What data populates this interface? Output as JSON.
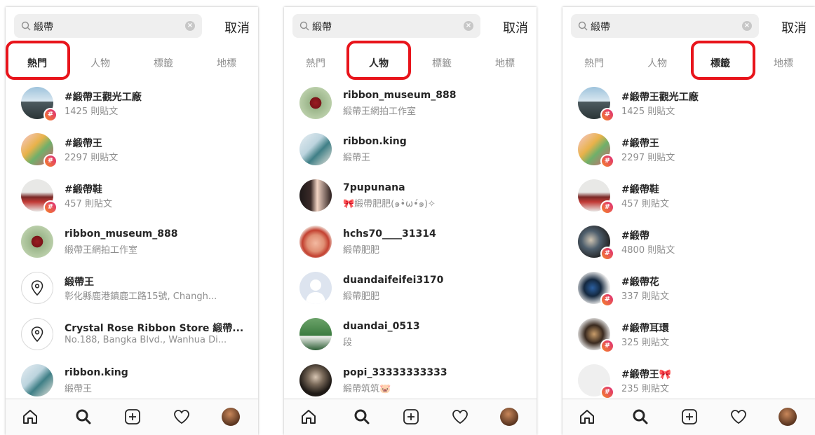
{
  "search": {
    "query": "緞帶",
    "cancel_label": "取消"
  },
  "tabs": [
    "熱門",
    "人物",
    "標籤",
    "地標"
  ],
  "accent_ring_color": "#e8141b",
  "screens": [
    {
      "active_tab": "熱門",
      "results": [
        {
          "title": "#緞帶王觀光工廠",
          "subtitle": "1425 則貼文",
          "kind": "hashtag",
          "avatar": "photo-sea"
        },
        {
          "title": "#緞帶王",
          "subtitle": "2297 則貼文",
          "kind": "hashtag",
          "avatar": "photo-shop"
        },
        {
          "title": "#緞帶鞋",
          "subtitle": "457 則貼文",
          "kind": "hashtag",
          "avatar": "photo-shoe"
        },
        {
          "title": "ribbon_museum_888",
          "subtitle": "緞帶王網拍工作室",
          "kind": "user",
          "avatar": "photo-bow"
        },
        {
          "title": "緞帶王",
          "subtitle": "彰化縣鹿港鎮鹿工路15號, Changh...",
          "kind": "place",
          "avatar": "location-pin-icon"
        },
        {
          "title": "Crystal Rose Ribbon Store 緞帶...",
          "subtitle": "No.188, Bangka Blvd., Wanhua Di...",
          "kind": "place",
          "avatar": "location-pin-icon"
        },
        {
          "title": "ribbon.king",
          "subtitle": "緞帶王",
          "kind": "user",
          "avatar": "photo-ribbonking"
        }
      ]
    },
    {
      "active_tab": "人物",
      "results": [
        {
          "title": "ribbon_museum_888",
          "subtitle": "緞帶王網拍工作室",
          "kind": "user",
          "avatar": "photo-bow"
        },
        {
          "title": "ribbon.king",
          "subtitle": "緞帶王",
          "kind": "user",
          "avatar": "photo-ribbonking"
        },
        {
          "title": "7pupunana",
          "subtitle": "🎀緞帶肥肥(๑•̀ω•́๑)✧",
          "kind": "user",
          "avatar": "photo-girl"
        },
        {
          "title": "hchs70____31314",
          "subtitle": "緞帶肥肥",
          "kind": "user",
          "avatar": "photo-pig"
        },
        {
          "title": "duandaifeifei3170",
          "subtitle": "緞帶肥肥",
          "kind": "user",
          "avatar": "default-user-icon"
        },
        {
          "title": "duandai_0513",
          "subtitle": "段",
          "kind": "user",
          "avatar": "photo-green"
        },
        {
          "title": "popi_33333333333",
          "subtitle": "緞帶筑筑🐷",
          "kind": "user",
          "avatar": "photo-dark"
        }
      ]
    },
    {
      "active_tab": "標籤",
      "results": [
        {
          "title": "#緞帶王觀光工廠",
          "subtitle": "1425 則貼文",
          "kind": "hashtag",
          "avatar": "photo-sea"
        },
        {
          "title": "#緞帶王",
          "subtitle": "2297 則貼文",
          "kind": "hashtag",
          "avatar": "photo-shop"
        },
        {
          "title": "#緞帶鞋",
          "subtitle": "457 則貼文",
          "kind": "hashtag",
          "avatar": "photo-shoe"
        },
        {
          "title": "#緞帶",
          "subtitle": "4800 則貼文",
          "kind": "hashtag",
          "avatar": "photo-yarn"
        },
        {
          "title": "#緞帶花",
          "subtitle": "337 則貼文",
          "kind": "hashtag",
          "avatar": "photo-flower"
        },
        {
          "title": "#緞帶耳環",
          "subtitle": "325 則貼文",
          "kind": "hashtag",
          "avatar": "photo-earring"
        },
        {
          "title": "#緞帶王🎀",
          "subtitle": "235 則貼文",
          "kind": "hashtag",
          "avatar": "photo-empty"
        }
      ]
    }
  ],
  "hashtag_badge": "#",
  "nav_icons": [
    "home-icon",
    "search-icon",
    "new-post-icon",
    "activity-heart-icon",
    "profile-avatar"
  ]
}
